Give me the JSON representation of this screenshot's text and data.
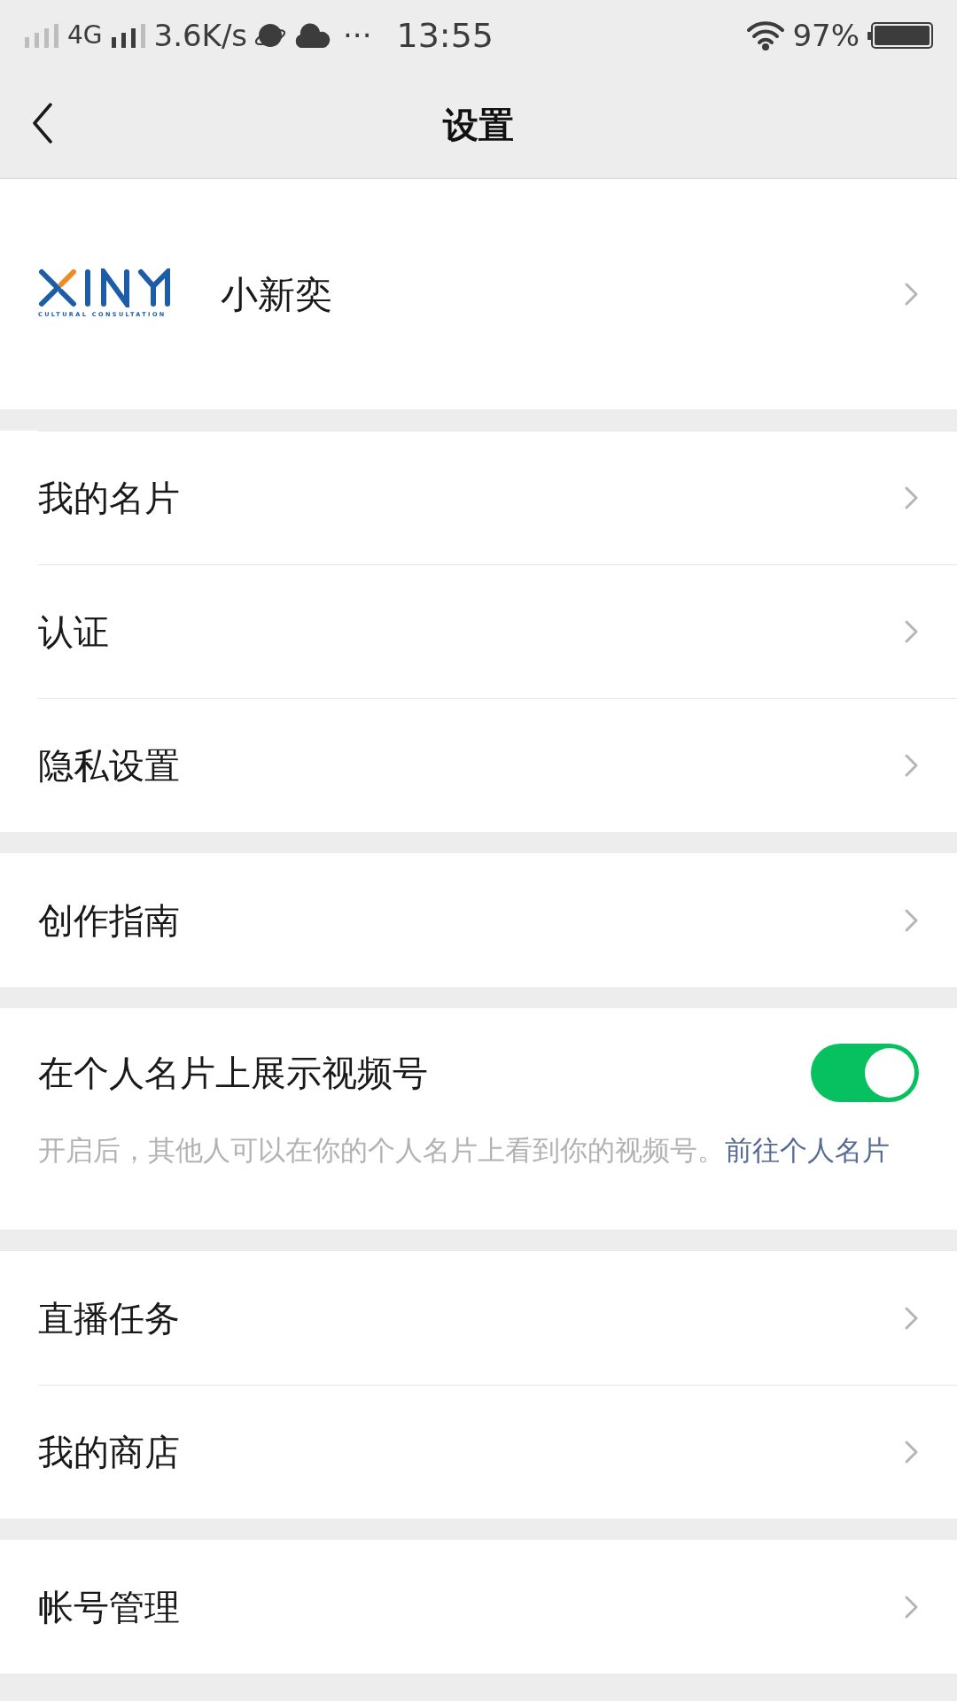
{
  "status_bar": {
    "network": "4G",
    "speed": "3.6K/s",
    "more": "···",
    "time": "13:55",
    "battery": "97%"
  },
  "nav": {
    "title": "设置"
  },
  "profile": {
    "logo_caption": "CULTURAL CONSULTATION",
    "name": "小新奕"
  },
  "groups": [
    {
      "items": [
        {
          "kind": "link",
          "label": "我的名片"
        },
        {
          "kind": "link",
          "label": "认证"
        },
        {
          "kind": "link",
          "label": "隐私设置"
        }
      ]
    },
    {
      "items": [
        {
          "kind": "link",
          "label": "创作指南"
        }
      ]
    },
    {
      "items": [
        {
          "kind": "toggle",
          "label": "在个人名片上展示视频号",
          "on": true,
          "description": "开启后，其他人可以在你的个人名片上看到你的视频号。",
          "link": "前往个人名片"
        }
      ]
    },
    {
      "items": [
        {
          "kind": "link",
          "label": "直播任务"
        },
        {
          "kind": "link",
          "label": "我的商店"
        }
      ]
    },
    {
      "items": [
        {
          "kind": "link",
          "label": "帐号管理"
        }
      ]
    }
  ]
}
